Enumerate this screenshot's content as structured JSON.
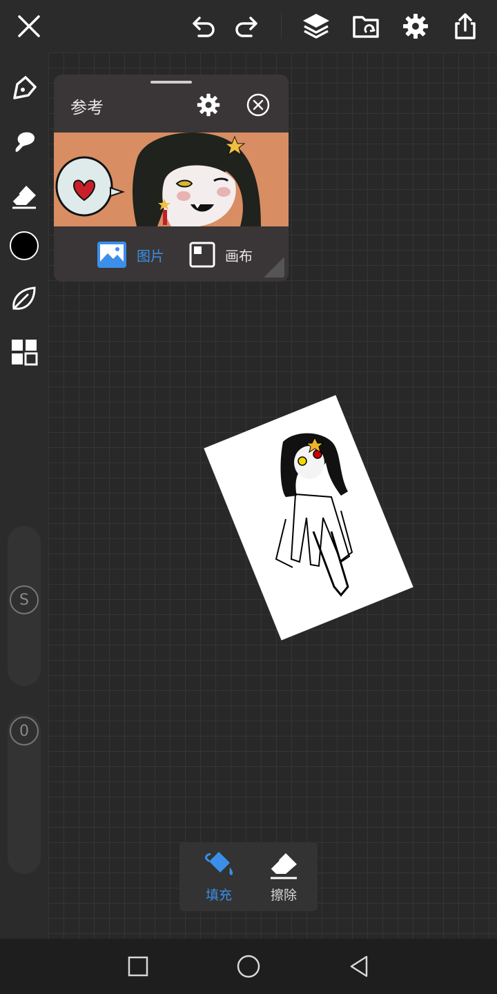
{
  "app": {
    "accent_color": "#3b8fe8",
    "icon_color": "#ffffff"
  },
  "top_bar": {
    "close_icon": "close-icon",
    "undo_icon": "undo-icon",
    "redo_icon": "redo-icon",
    "layers_icon": "layers-icon",
    "import_icon": "folder-import-icon",
    "settings_icon": "gear-icon",
    "share_icon": "share-icon"
  },
  "left_toolbar": {
    "tools": [
      "pen-icon",
      "smudge-icon",
      "eraser-icon",
      "color-swatch",
      "leaf-icon",
      "grid-icon"
    ],
    "current_color": "#000000",
    "size_slider": {
      "label": "S"
    },
    "opacity_slider": {
      "label": "0"
    }
  },
  "reference_panel": {
    "title": "参考",
    "tabs": [
      {
        "label": "图片",
        "active": true
      },
      {
        "label": "画布",
        "active": false
      }
    ]
  },
  "fill_toolbar": {
    "items": [
      {
        "label": "填充",
        "active": true
      },
      {
        "label": "擦除",
        "active": false
      }
    ]
  },
  "nav_bar": {
    "buttons": [
      "recent-apps-icon",
      "home-icon",
      "back-icon"
    ]
  }
}
